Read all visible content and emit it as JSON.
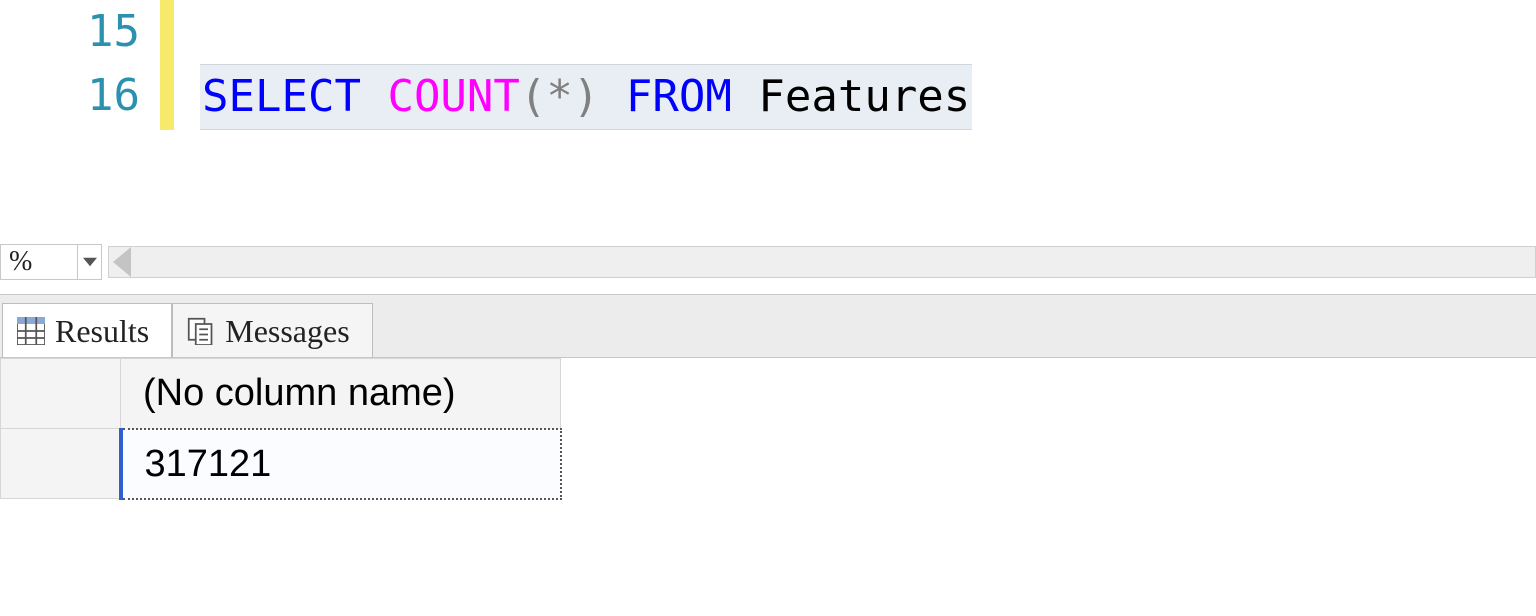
{
  "editor": {
    "lines": [
      {
        "num": "15",
        "tokens": []
      },
      {
        "num": "16",
        "tokens": [
          {
            "t": "SELECT",
            "c": "kw"
          },
          {
            "t": " ",
            "c": ""
          },
          {
            "t": "COUNT",
            "c": "fn"
          },
          {
            "t": "(",
            "c": "pn"
          },
          {
            "t": "*",
            "c": "pn"
          },
          {
            "t": ")",
            "c": "pn"
          },
          {
            "t": " ",
            "c": ""
          },
          {
            "t": "FROM",
            "c": "kw"
          },
          {
            "t": " Features",
            "c": ""
          }
        ]
      }
    ]
  },
  "zoom": {
    "value": " %"
  },
  "tabs": {
    "results": "Results",
    "messages": "Messages"
  },
  "grid": {
    "header": "(No column name)",
    "value": "317121"
  }
}
